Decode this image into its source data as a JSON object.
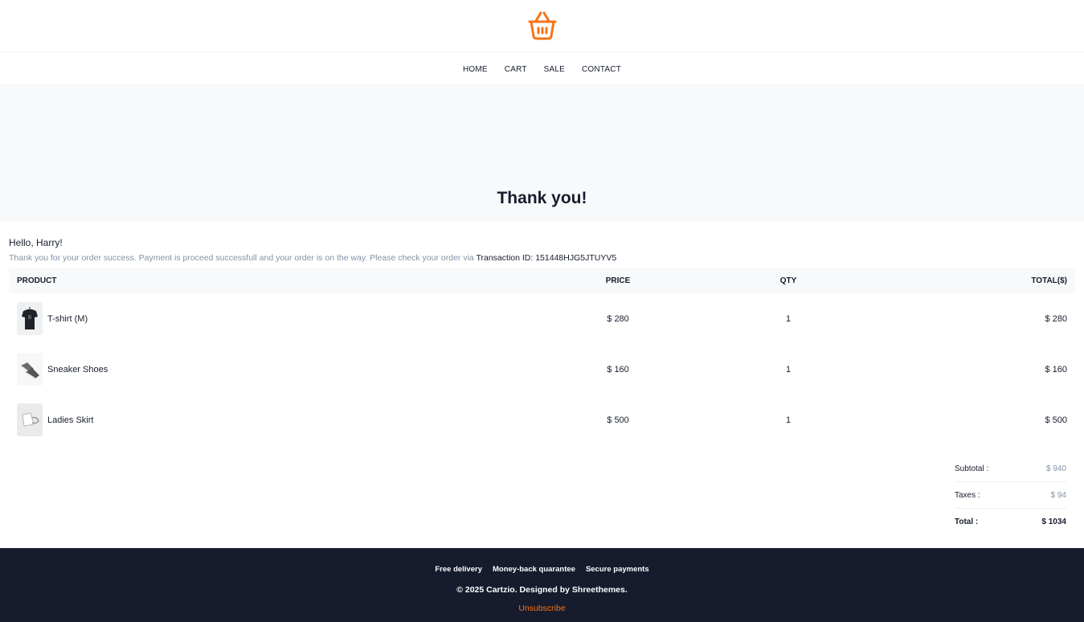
{
  "brand": {
    "logo_icon": "basket-icon",
    "accent": "#f97316"
  },
  "nav": [
    {
      "label": "HOME"
    },
    {
      "label": "CART"
    },
    {
      "label": "SALE"
    },
    {
      "label": "CONTACT"
    }
  ],
  "hero": {
    "title": "Thank you!"
  },
  "message": {
    "greeting": "Hello, Harry!",
    "note": "Thank you for your order success. Payment is proceed successfull and your order is on the way. Please check your order via",
    "transaction": "Transaction ID: 151448HJG5JTUYV5"
  },
  "table": {
    "headers": {
      "product": "PRODUCT",
      "price": "PRICE",
      "qty": "QTY",
      "total": "TOTAL($)"
    },
    "rows": [
      {
        "name": "T-shirt (M)",
        "price": "$ 280",
        "qty": "1",
        "total": "$ 280",
        "icon": "tshirt-thumbnail"
      },
      {
        "name": "Sneaker Shoes",
        "price": "$ 160",
        "qty": "1",
        "total": "$ 160",
        "icon": "sneaker-thumbnail"
      },
      {
        "name": "Ladies Skirt",
        "price": "$ 500",
        "qty": "1",
        "total": "$ 500",
        "icon": "skirt-thumbnail"
      }
    ]
  },
  "summary": {
    "subtotal_label": "Subtotal :",
    "subtotal": "$ 940",
    "taxes_label": "Taxes :",
    "taxes": "$ 94",
    "total_label": "Total :",
    "total": "$ 1034"
  },
  "footer": {
    "links": [
      "Free delivery",
      "Money-back quarantee",
      "Secure payments"
    ],
    "copyright": "© 2025 Cartzio. Designed by Shreethemes.",
    "unsubscribe": "Unsubscribe",
    "background": "#161c2d"
  }
}
